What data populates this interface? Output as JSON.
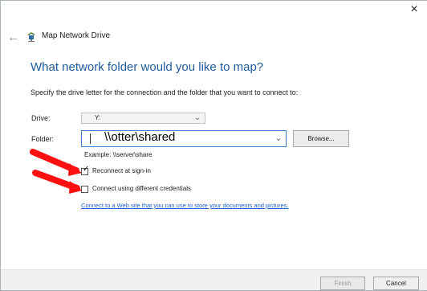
{
  "window": {
    "title": "Map Network Drive",
    "close_icon": "×",
    "back_icon": "←"
  },
  "dialog": {
    "heading": "What network folder would you like to map?",
    "instruction": "Specify the drive letter for the connection and the folder that you want to connect to:"
  },
  "form": {
    "drive_label": "Drive:",
    "drive_value": "Y:",
    "folder_label": "Folder:",
    "folder_value": "\\\\otter\\shared",
    "browse_label": "Browse...",
    "example": "Example: \\\\server\\share",
    "reconnect_label": "Reconnect at sign-in",
    "credentials_label": "Connect using different credentials",
    "reconnect_checked": true,
    "credentials_checked": false,
    "link": "Connect to a Web site that you can use to store your documents and pictures."
  },
  "footer": {
    "finish_label": "Finish",
    "cancel_label": "Cancel"
  },
  "icons": {
    "back": "back-arrow-icon",
    "drive": "network-drive-icon",
    "dropdown": "chevron-down-icon",
    "checkmark": "checkmark-icon",
    "annotation": "red-arrow-icon"
  },
  "colors": {
    "heading": "#1f5a9b",
    "link": "#1d5ed0",
    "annotation": "#ff1010"
  }
}
